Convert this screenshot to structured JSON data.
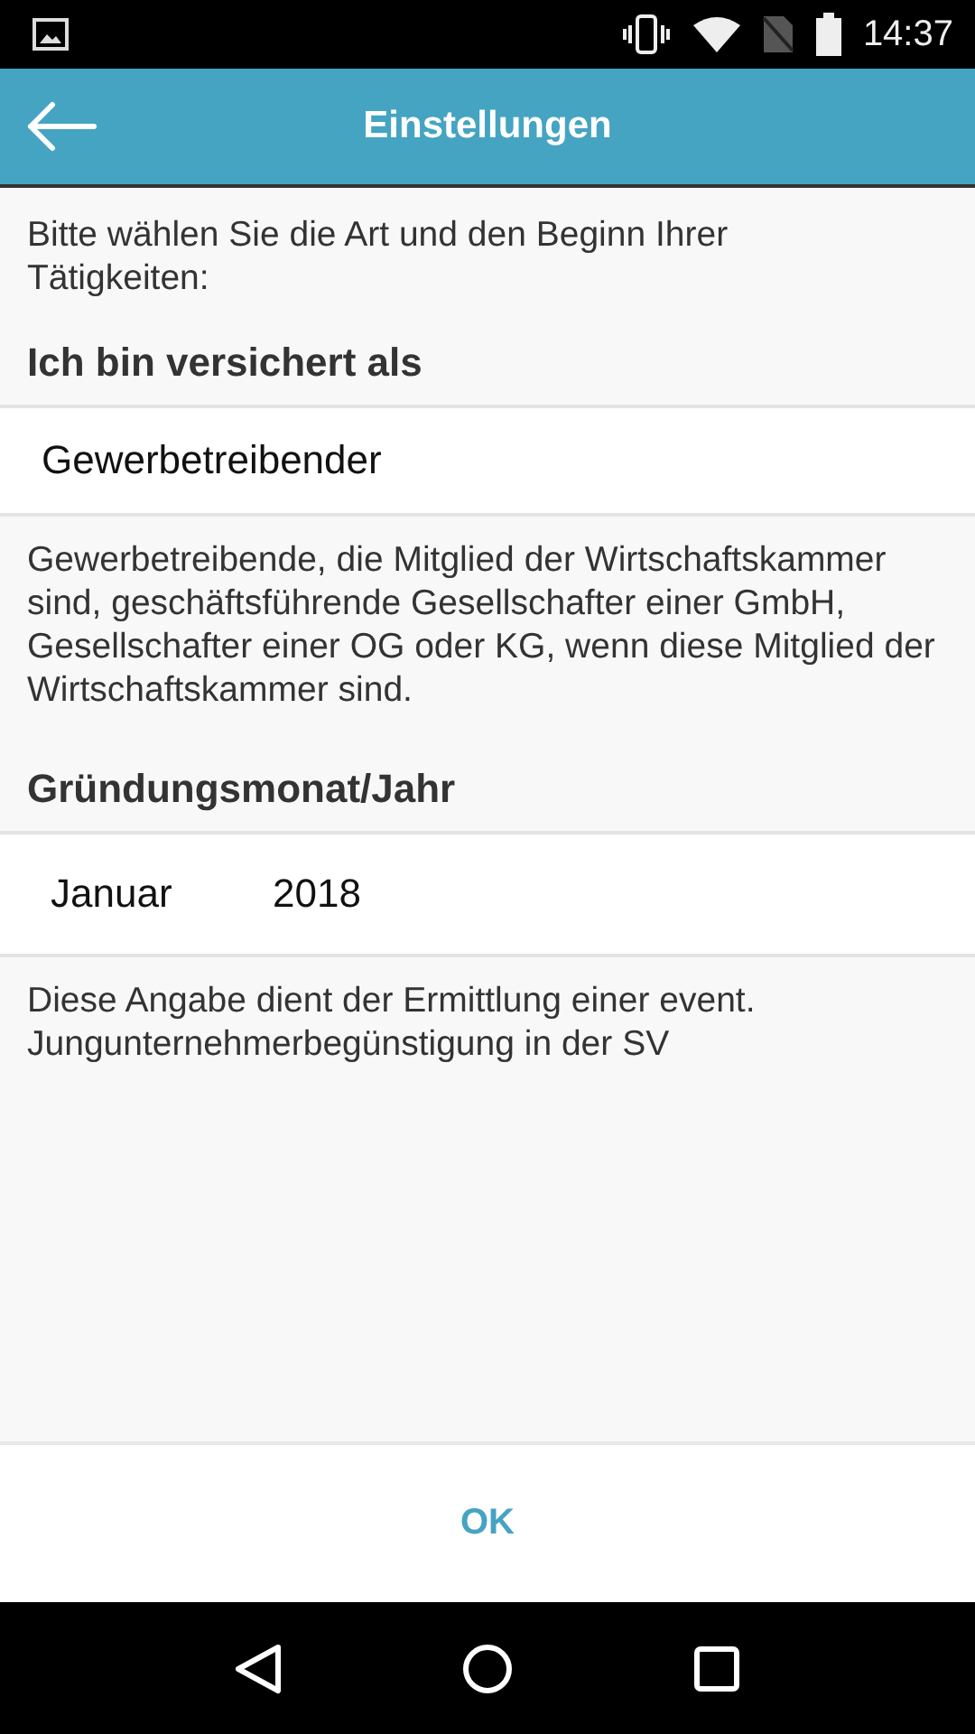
{
  "status_bar": {
    "time": "14:37"
  },
  "app_bar": {
    "title": "Einstellungen"
  },
  "intro": "Bitte wählen Sie die Art und den Beginn Ihrer Tätigkeiten:",
  "insurance": {
    "heading": "Ich bin versichert als",
    "value": "Gewerbetreibender",
    "description": "Gewerbetreibende, die Mitglied der Wirtschaftskammer sind, geschäftsführende Gesellschafter einer GmbH, Gesellschafter einer OG oder KG, wenn diese Mitglied der Wirtschaftskammer sind."
  },
  "founding": {
    "heading": "Gründungsmonat/Jahr",
    "month": "Januar",
    "year": "2018",
    "note": "Diese Angabe dient der Ermittlung einer event. Jungunternehmerbegünstigung in der SV"
  },
  "ok_button": "OK"
}
